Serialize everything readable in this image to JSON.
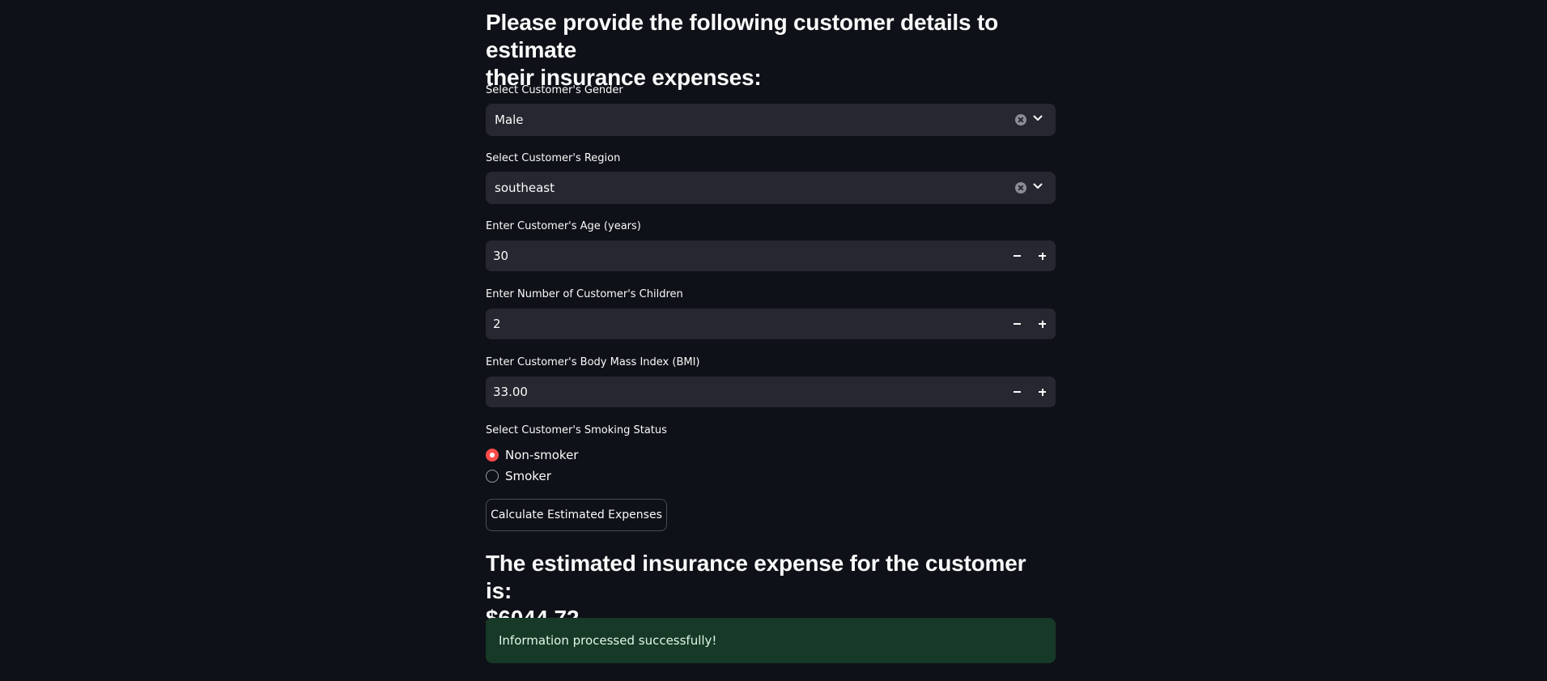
{
  "form": {
    "heading_line1": "Please provide the following customer details to estimate",
    "heading_line2": "their insurance expenses:",
    "gender": {
      "label": "Select Customer's Gender",
      "value": "Male"
    },
    "region": {
      "label": "Select Customer's Region",
      "value": "southeast"
    },
    "age": {
      "label": "Enter Customer's Age (years)",
      "value": "30"
    },
    "children": {
      "label": "Enter Number of Customer's Children",
      "value": "2"
    },
    "bmi": {
      "label": "Enter Customer's Body Mass Index (BMI)",
      "value": "33.00"
    },
    "smoking": {
      "label": "Select Customer's Smoking Status",
      "options": [
        "Non-smoker",
        "Smoker"
      ],
      "selected": "Non-smoker"
    },
    "calculate_label": "Calculate Estimated Expenses"
  },
  "result": {
    "line1": "The estimated insurance expense for the customer is:",
    "line2": "$6044.72"
  },
  "alert": {
    "message": "Information processed successfully!",
    "color": "#173928"
  },
  "theme": {
    "background": "#0e1117",
    "input_background": "#262730",
    "accent": "#ff4b4b"
  },
  "icons": {
    "clear": "clear-icon",
    "dropdown": "chevron-down-icon",
    "decrement": "minus-icon",
    "increment": "plus-icon"
  }
}
